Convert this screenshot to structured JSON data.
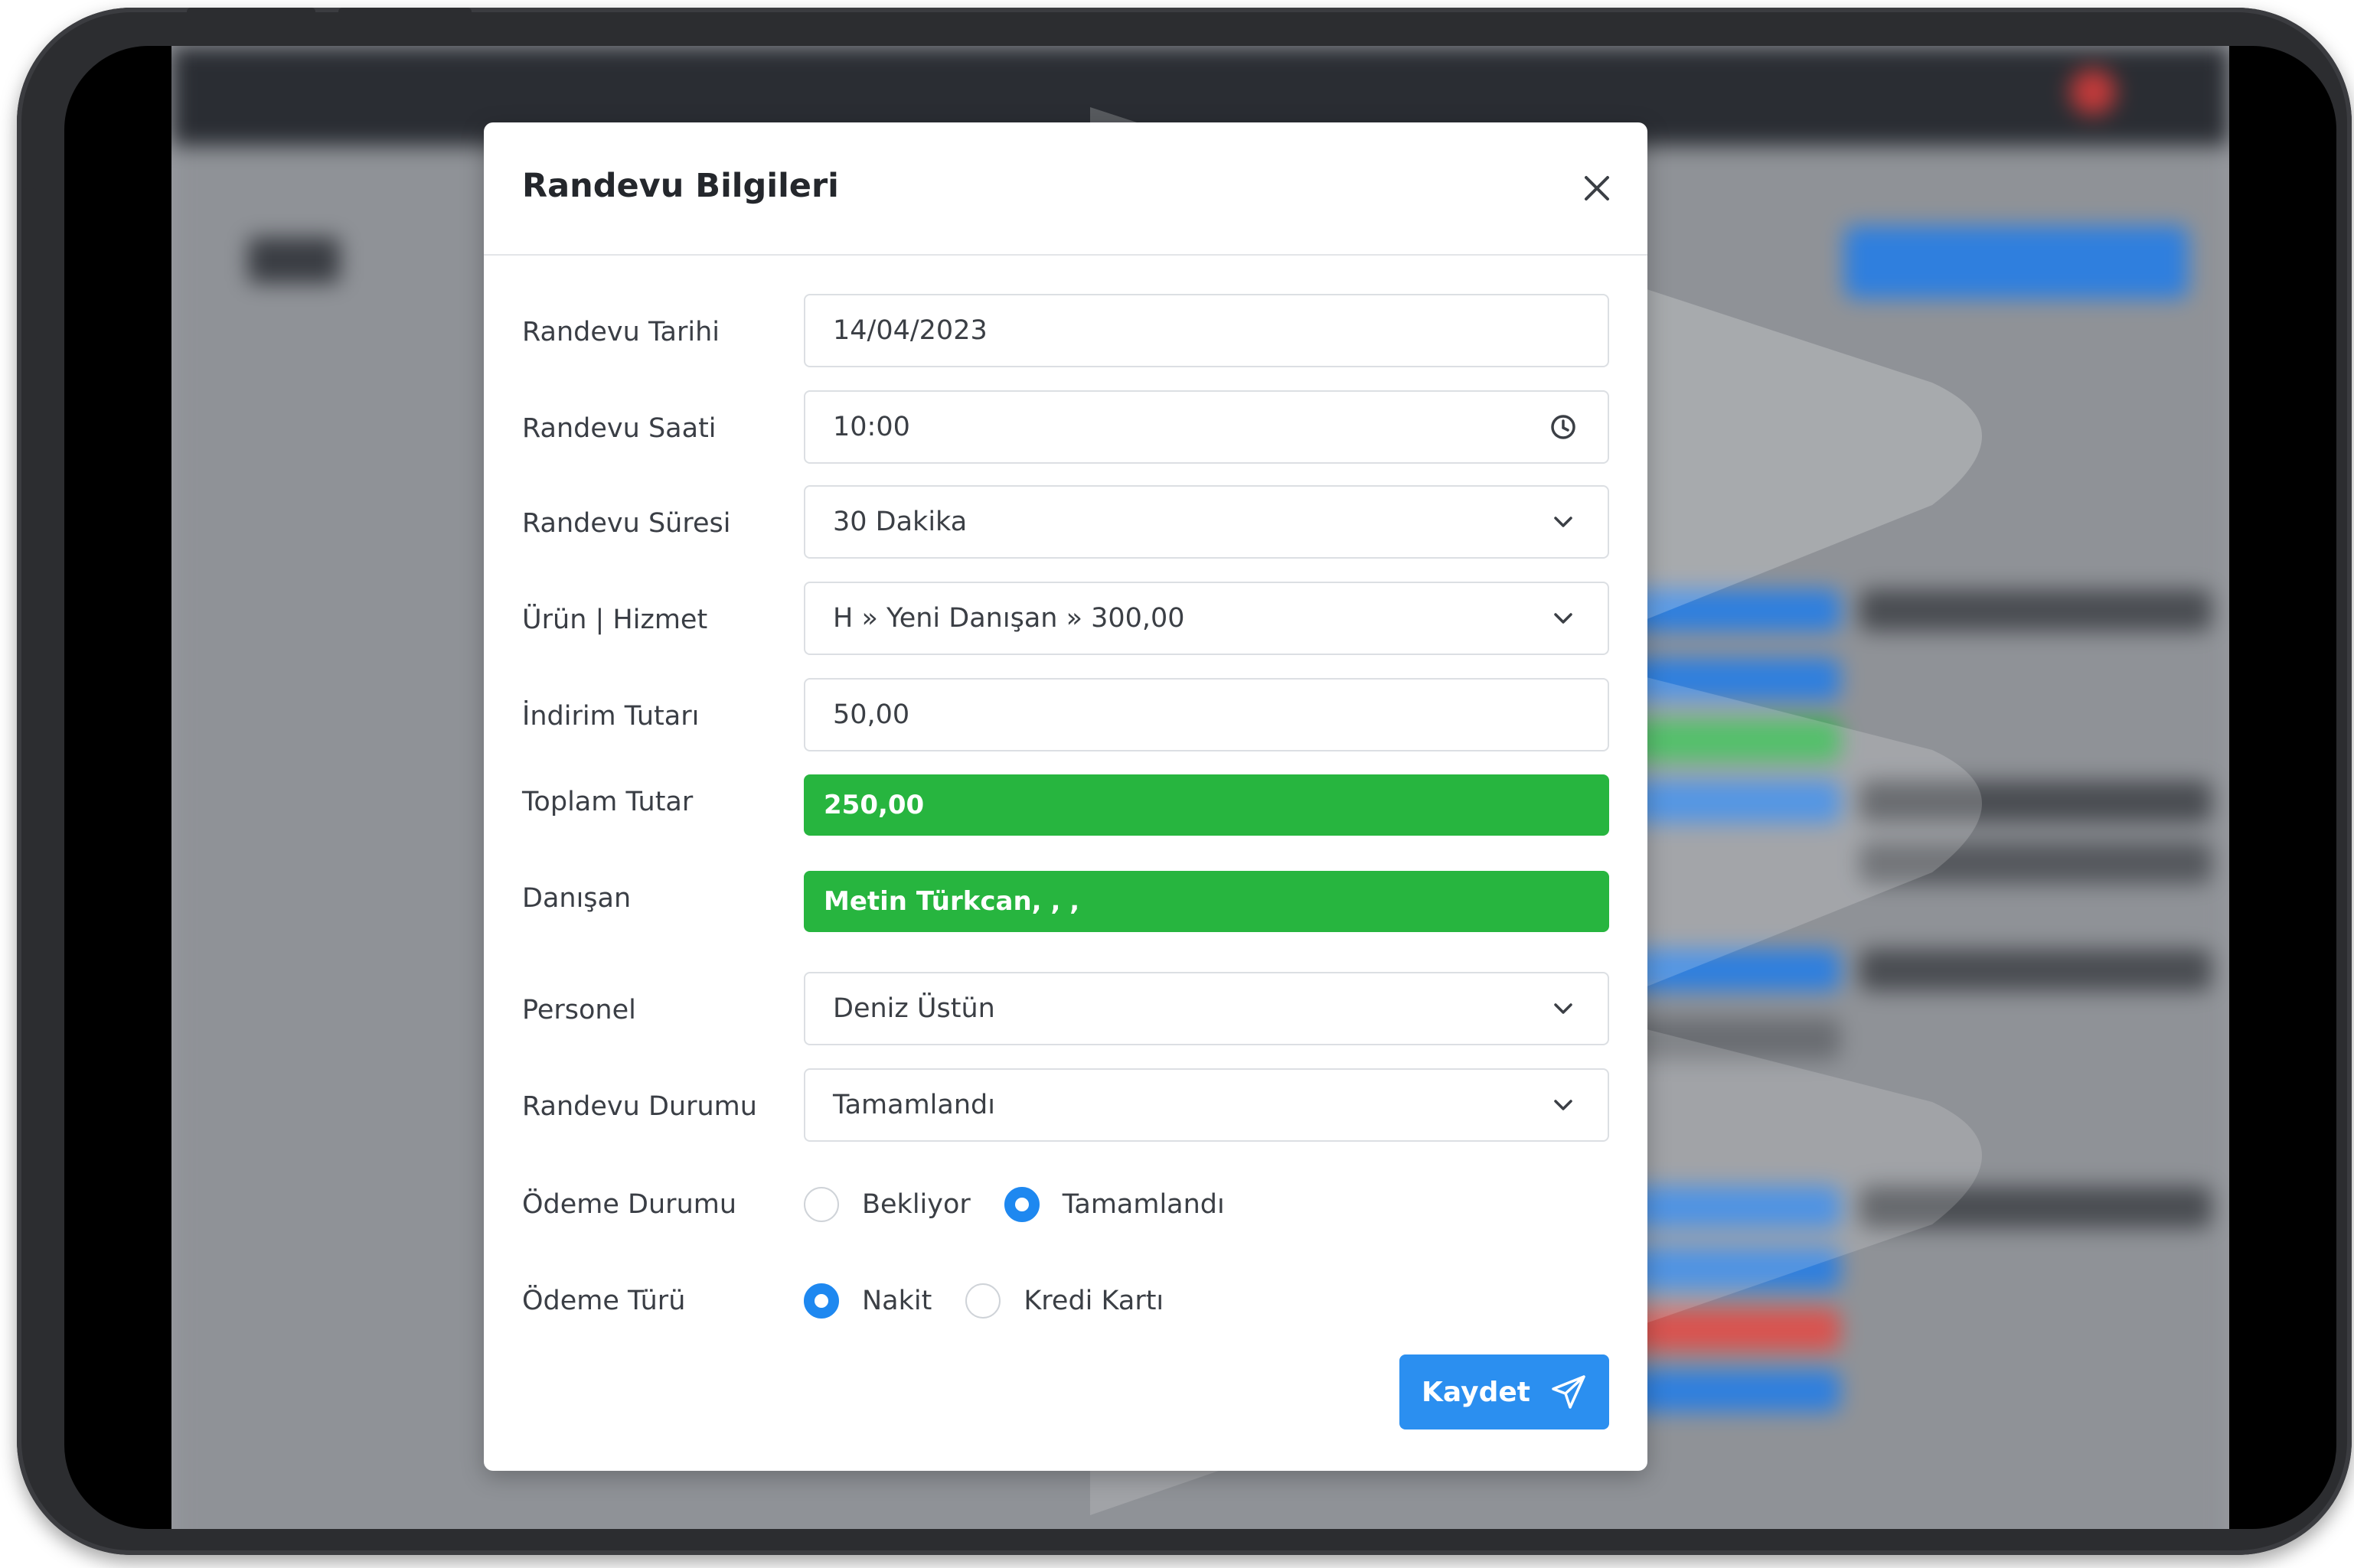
{
  "modal": {
    "title": "Randevu Bilgileri",
    "close_icon": "close-icon"
  },
  "form": {
    "date": {
      "label": "Randevu Tarihi",
      "value": "14/04/2023"
    },
    "time": {
      "label": "Randevu Saati",
      "value": "10:00",
      "icon": "clock-icon"
    },
    "duration": {
      "label": "Randevu Süresi",
      "value": "30 Dakika",
      "icon": "chevron-down-icon"
    },
    "product": {
      "label": "Ürün | Hizmet",
      "value": "H » Yeni Danışan » 300,00",
      "icon": "chevron-down-icon"
    },
    "discount": {
      "label": "İndirim Tutarı",
      "value": "50,00"
    },
    "total": {
      "label": "Toplam Tutar",
      "value": "250,00"
    },
    "client": {
      "label": "Danışan",
      "value": "Metin Türkcan, , ,"
    },
    "staff": {
      "label": "Personel",
      "value": "Deniz Üstün",
      "icon": "chevron-down-icon"
    },
    "status": {
      "label": "Randevu Durumu",
      "value": "Tamamlandı",
      "icon": "chevron-down-icon"
    },
    "payment_status": {
      "label": "Ödeme Durumu",
      "options": [
        {
          "label": "Bekliyor",
          "checked": false
        },
        {
          "label": "Tamamlandı",
          "checked": true
        }
      ]
    },
    "payment_type": {
      "label": "Ödeme Türü",
      "options": [
        {
          "label": "Nakit",
          "checked": true
        },
        {
          "label": "Kredi Kartı",
          "checked": false
        }
      ]
    }
  },
  "actions": {
    "save_label": "Kaydet",
    "save_icon": "send-icon"
  },
  "colors": {
    "primary": "#2b8ff0",
    "success": "#27b53f",
    "device": "#2c2d30"
  }
}
